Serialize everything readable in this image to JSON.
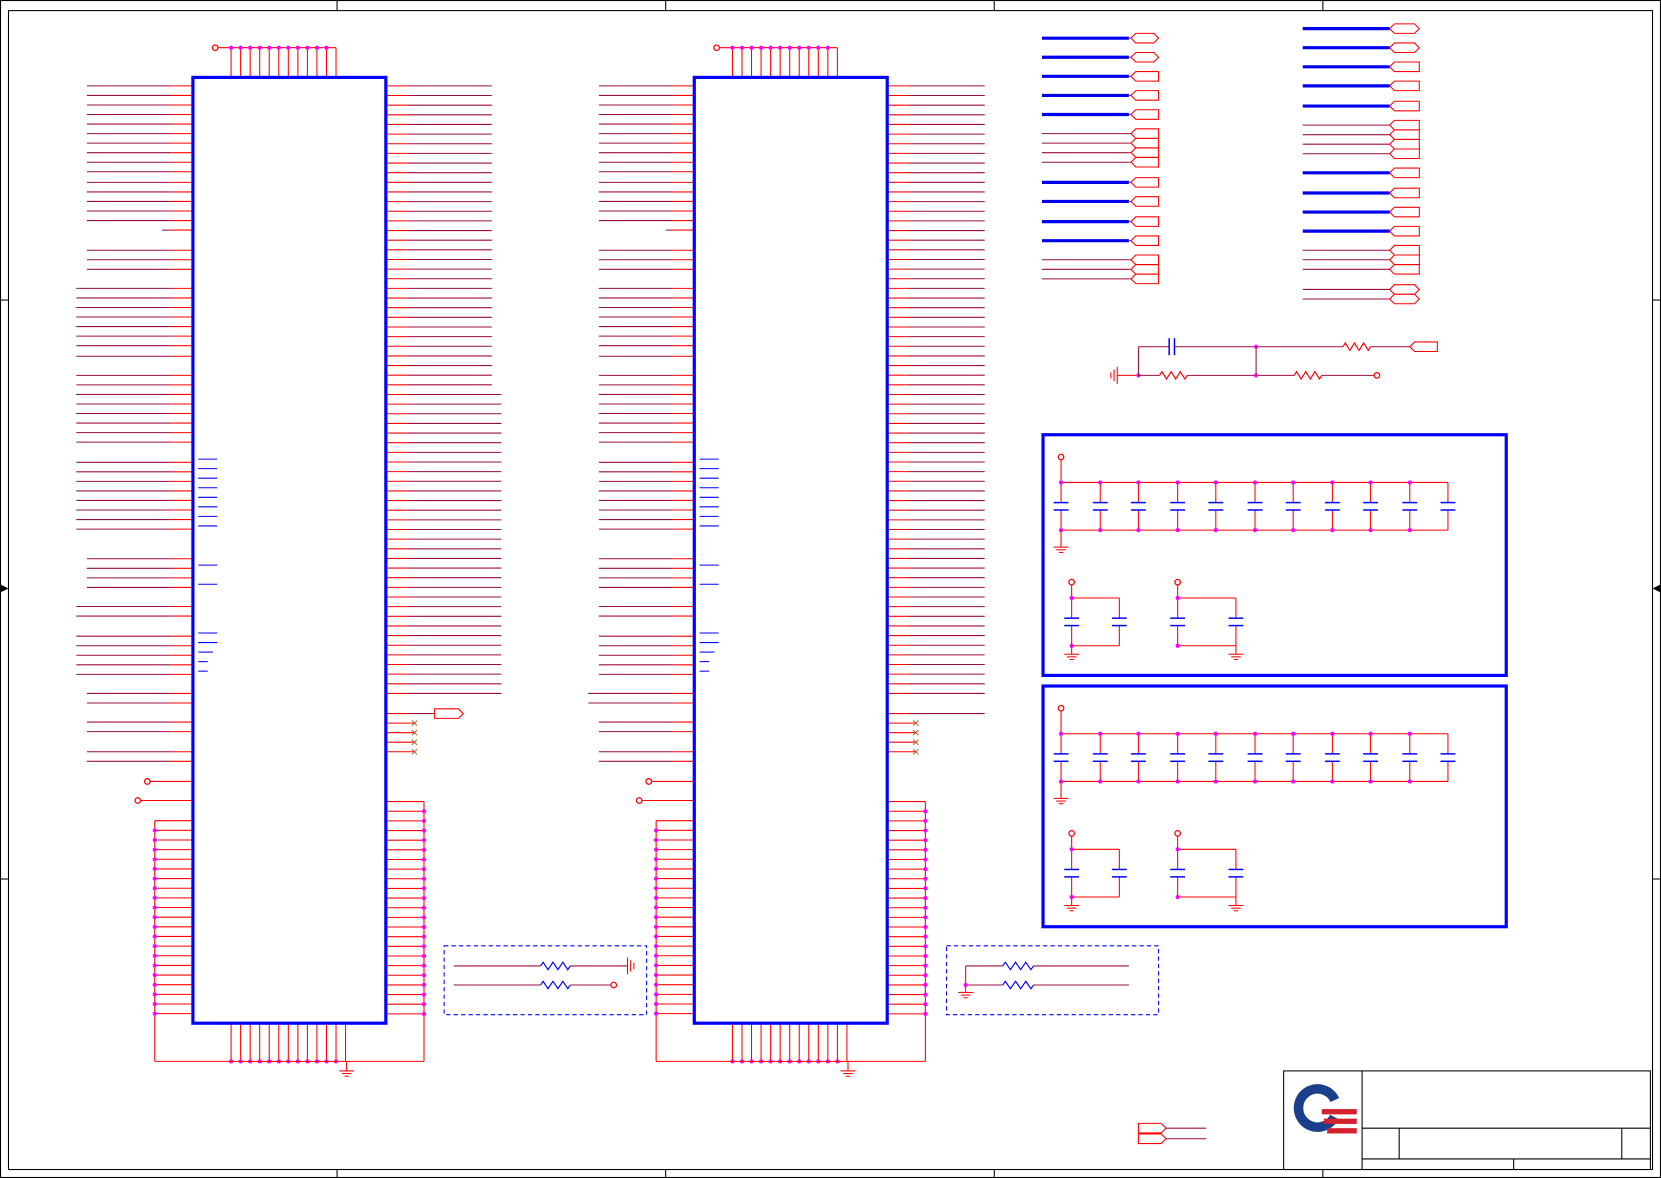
{
  "colors": {
    "background": "#ffffff",
    "frame": "#000000",
    "component_outline": "#0000ff",
    "pin": "#ff0000",
    "wire": "#9a0e3e",
    "junction": "#ff00ff",
    "bus": "#0000ee",
    "graphic": "#0000ff",
    "no_connect": "#b06020",
    "logo_blue": "#1b3f8b",
    "logo_red": "#d3212d"
  },
  "icons": {
    "logo": "company-logo-icon",
    "ground": "ground-icon",
    "earth": "earth-ground-icon",
    "power_port": "power-port-icon",
    "resistor": "resistor-icon",
    "capacitor": "capacitor-icon",
    "offpage_connector": "offpage-connector-icon",
    "no_connect": "no-connect-icon",
    "junction": "junction-dot"
  }
}
